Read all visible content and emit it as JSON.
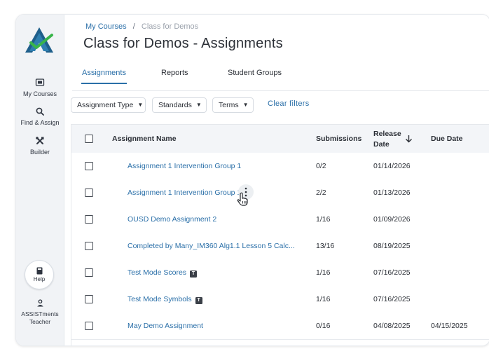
{
  "app": {
    "brand_colors": {
      "primary": "#2a6fa8",
      "logo_blue": "#1f5f8b",
      "logo_green": "#39b54a"
    }
  },
  "sidebar": {
    "items": [
      {
        "label": "My Courses",
        "icon": "course-icon"
      },
      {
        "label": "Find & Assign",
        "icon": "search-icon"
      },
      {
        "label": "Builder",
        "icon": "tools-icon"
      }
    ],
    "help": {
      "label": "Help",
      "icon": "book-icon"
    },
    "user": {
      "line1": "ASSISTments",
      "line2": "Teacher",
      "icon": "user-icon"
    }
  },
  "header": {
    "breadcrumb": {
      "link": "My Courses",
      "separator": "/",
      "current": "Class for Demos"
    },
    "title": "Class for Demos - Assignments"
  },
  "tabs": [
    {
      "label": "Assignments",
      "active": true
    },
    {
      "label": "Reports",
      "active": false
    },
    {
      "label": "Student Groups",
      "active": false
    }
  ],
  "filters": [
    {
      "label": "Assignment Type"
    },
    {
      "label": "Standards"
    },
    {
      "label": "Terms"
    }
  ],
  "clear_filters_label": "Clear filters",
  "table": {
    "headers": {
      "name": "Assignment Name",
      "submissions": "Submissions",
      "release_line1": "Release",
      "release_line2": "Date",
      "due": "Due Date"
    },
    "rows": [
      {
        "name": "Assignment 1 Intervention Group 1",
        "submissions": "0/2",
        "release": "01/14/2026",
        "due": "",
        "badge": ""
      },
      {
        "name": "Assignment 1 Intervention Group 1",
        "submissions": "2/2",
        "release": "01/13/2026",
        "due": "",
        "badge": ""
      },
      {
        "name": "OUSD Demo Assignment 2",
        "submissions": "1/16",
        "release": "01/09/2026",
        "due": "",
        "badge": ""
      },
      {
        "name": "Completed by Many_IM360 Alg1.1 Lesson 5 Calc...",
        "submissions": "13/16",
        "release": "08/19/2025",
        "due": "",
        "badge": ""
      },
      {
        "name": "Test Mode Scores",
        "submissions": "1/16",
        "release": "07/16/2025",
        "due": "",
        "badge": "T"
      },
      {
        "name": "Test Mode Symbols",
        "submissions": "1/16",
        "release": "07/16/2025",
        "due": "",
        "badge": "T"
      },
      {
        "name": "May Demo Assignment",
        "submissions": "0/16",
        "release": "04/08/2025",
        "due": "04/15/2025",
        "badge": ""
      }
    ]
  }
}
